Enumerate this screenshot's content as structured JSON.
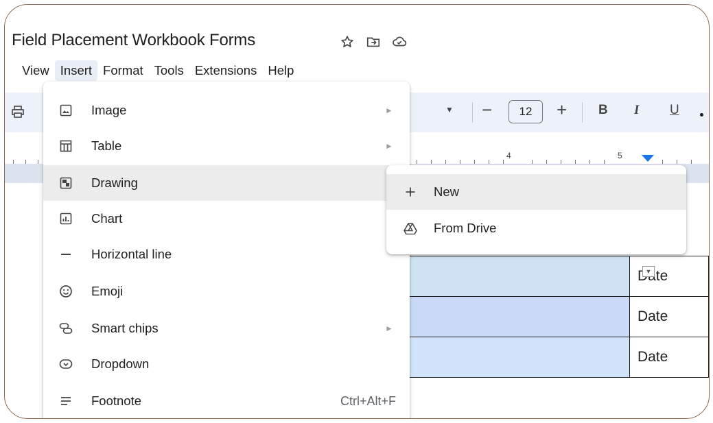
{
  "document": {
    "title": "Field Placement Workbook Forms",
    "title_icons": [
      "star-icon",
      "move-to-folder-icon",
      "cloud-saved-icon"
    ]
  },
  "menubar": {
    "items": [
      "View",
      "Insert",
      "Format",
      "Tools",
      "Extensions",
      "Help"
    ],
    "active": "Insert"
  },
  "toolbar": {
    "font_size": "12",
    "minus": "−",
    "plus": "+",
    "bold": "B",
    "italic": "I",
    "underline": "U"
  },
  "ruler": {
    "numbers": [
      "4",
      "5"
    ]
  },
  "insert_menu": {
    "items": [
      {
        "label": "Image",
        "icon": "image-icon",
        "submenu": true
      },
      {
        "label": "Table",
        "icon": "table-icon",
        "submenu": true
      },
      {
        "label": "Drawing",
        "icon": "drawing-icon",
        "submenu": true,
        "hovered": true
      },
      {
        "label": "Chart",
        "icon": "chart-icon",
        "submenu": true
      },
      {
        "label": "Horizontal line",
        "icon": "horizontal-line-icon",
        "submenu": false
      },
      {
        "label": "Emoji",
        "icon": "emoji-icon",
        "submenu": false
      },
      {
        "label": "Smart chips",
        "icon": "smart-chips-icon",
        "submenu": true
      },
      {
        "label": "Dropdown",
        "icon": "dropdown-icon",
        "submenu": false
      },
      {
        "label": "Footnote",
        "icon": "footnote-icon",
        "submenu": false,
        "shortcut": "Ctrl+Alt+F"
      }
    ]
  },
  "drawing_submenu": {
    "items": [
      {
        "label": "New",
        "icon": "plus-icon",
        "hovered": true
      },
      {
        "label": "From Drive",
        "icon": "drive-icon"
      }
    ]
  },
  "table_cells": {
    "date_labels": [
      "Date",
      "Date",
      "Date"
    ]
  },
  "colors": {
    "toolbar_bg": "#edf2fa",
    "menu_hover": "#ececec",
    "active_menu": "#e9eef6",
    "ruler_marker": "#1a73e8",
    "cell_row1": "#cfe2f3",
    "cell_row2": "#c9daf8",
    "cell_row3": "#d2e3fc"
  }
}
